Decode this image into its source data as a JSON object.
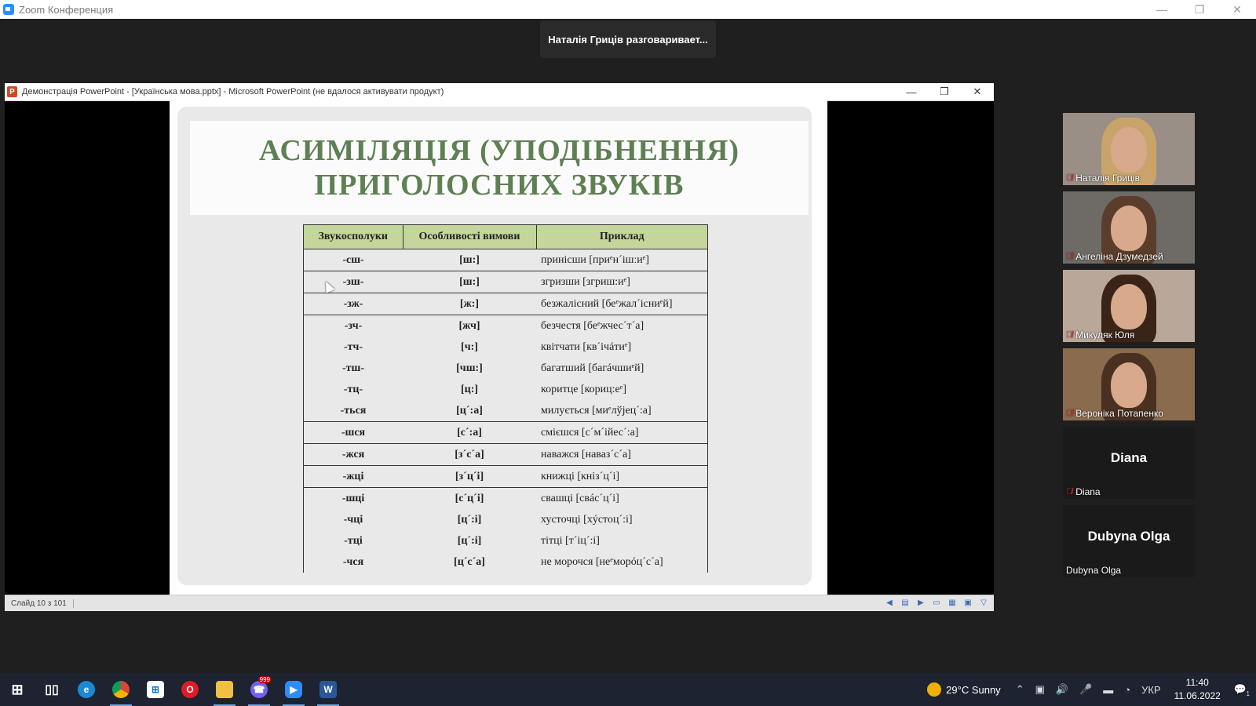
{
  "zoom": {
    "title": "Zoom Конференция",
    "speaking": "Наталія Гриців разговаривает..."
  },
  "ppt": {
    "title": "Демонстрація PowerPoint - [Українська мова.pptx] - Microsoft PowerPoint (не вдалося активувати продукт)",
    "slide_counter": "Слайд 10 з 101"
  },
  "slide": {
    "title_line1": "АСИМІЛЯЦІЯ (УПОДІБНЕННЯ)",
    "title_line2": "ПРИГОЛОСНИХ ЗВУКІВ",
    "headers": [
      "Звукосполуки",
      "Особливості вимови",
      "Приклад"
    ],
    "rows": [
      [
        "-сш-",
        "[ш:]",
        "принісши [приᵉн´ішːиᵉ]"
      ],
      [
        "-зш-",
        "[ш:]",
        "згризши [згриш:иᵉ]"
      ],
      [
        "-зж-",
        "[ж:]",
        "безжалісний [беᵉжал´існиᵉй]"
      ],
      [
        "-зч-",
        "[жч]",
        "безчестя [беᵉжчес´т´а]"
      ],
      [
        "-тч-",
        "[ч:]",
        "квітчати [кв´ічáтиᵉ]"
      ],
      [
        "-тш-",
        "[чш:]",
        "багатший [багáчшиᵉй]"
      ],
      [
        "-тц-",
        "[ц:]",
        "коритце [кориц:еᵉ]"
      ],
      [
        "-ться",
        "[ц´:а]",
        "милується [миᵉлўјец´:а]"
      ],
      [
        "-шся",
        "[с´:а]",
        "смієшся [с´м´ійес´:а]"
      ],
      [
        "-жся",
        "[з´с´а]",
        "наважся [наваз´с´а]"
      ],
      [
        "-жці",
        "[з´ц´і]",
        "книжці [кніз´ц´і]"
      ],
      [
        "-шці",
        "[с´ц´і]",
        "свашці [свáс´ц´і]"
      ],
      [
        "-чці",
        "[ц´:і]",
        "хусточці [хýстоц´:і]"
      ],
      [
        "-тці",
        "[ц´:і]",
        "тітці [т´іц´:і]"
      ],
      [
        "-чся",
        "[ц´с´а]",
        "не морочся [неᵉморóц´с´а]"
      ]
    ]
  },
  "participants": [
    {
      "name": "Наталія Гриців",
      "bg": "#9a8f86",
      "hair": "#c9a46a"
    },
    {
      "name": "Ангеліна Дзумедзей",
      "bg": "#6e6a66",
      "hair": "#5a3d2a"
    },
    {
      "name": "Микуляк Юля",
      "bg": "#b9a89a",
      "hair": "#3a2418"
    },
    {
      "name": "Вероніка Потапенко",
      "bg": "#8a6b4e",
      "hair": "#4a3020"
    },
    {
      "name": "Diana",
      "big": "Diana"
    },
    {
      "name": "Dubyna Olga",
      "big": "Dubyna Olga"
    }
  ],
  "taskbar": {
    "weather": "29°C  Sunny",
    "lang": "УКР",
    "time": "11:40",
    "date": "11.06.2022",
    "notif_count": "1",
    "viber_badge": "999"
  },
  "colors": {
    "title_green": "#5f7f54",
    "header_green": "#c3d69b",
    "mic_red": "#e02828"
  }
}
